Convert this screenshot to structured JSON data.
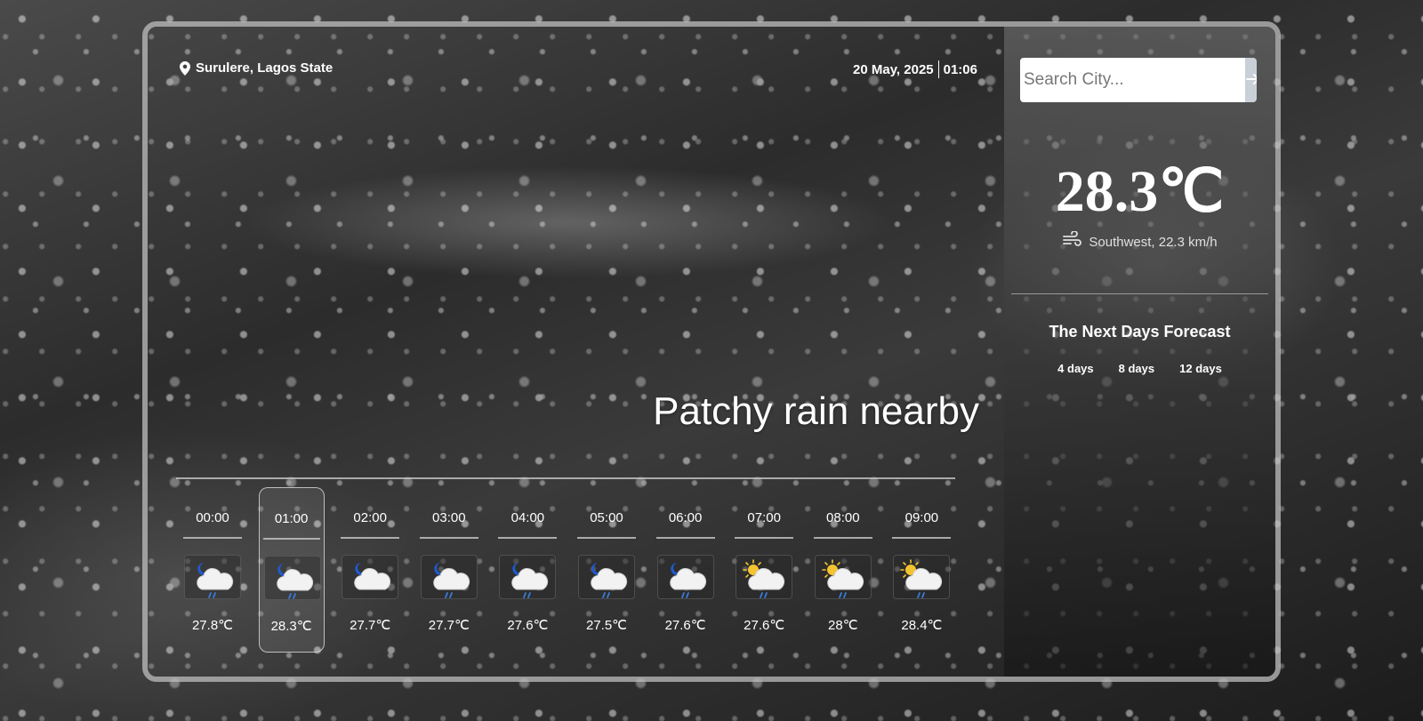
{
  "location": {
    "text": "Surulere, Lagos State",
    "icon": "map-pin-icon"
  },
  "date": "20 May, 2025",
  "time": "01:06",
  "condition": "Patchy rain nearby",
  "hourly": [
    {
      "time": "00:00",
      "temp": "27.8℃",
      "icon": "night-rain-icon",
      "active": false
    },
    {
      "time": "01:00",
      "temp": "28.3℃",
      "icon": "night-rain-icon",
      "active": true
    },
    {
      "time": "02:00",
      "temp": "27.7℃",
      "icon": "night-cloudy-icon",
      "active": false
    },
    {
      "time": "03:00",
      "temp": "27.7℃",
      "icon": "night-rain-icon",
      "active": false
    },
    {
      "time": "04:00",
      "temp": "27.6℃",
      "icon": "night-rain-icon",
      "active": false
    },
    {
      "time": "05:00",
      "temp": "27.5℃",
      "icon": "night-rain-icon",
      "active": false
    },
    {
      "time": "06:00",
      "temp": "27.6℃",
      "icon": "night-rain-icon",
      "active": false
    },
    {
      "time": "07:00",
      "temp": "27.6℃",
      "icon": "day-rain-icon",
      "active": false
    },
    {
      "time": "08:00",
      "temp": "28℃",
      "icon": "day-rain-icon",
      "active": false
    },
    {
      "time": "09:00",
      "temp": "28.4℃",
      "icon": "day-rain-icon",
      "active": false
    }
  ],
  "search": {
    "placeholder": "Search City...",
    "button_icon": "arrow-right-icon"
  },
  "current": {
    "temp": "28.3℃",
    "wind": "Southwest, 22.3 km/h",
    "wind_icon": "wind-icon"
  },
  "forecast": {
    "title": "The Next Days Forecast",
    "options": [
      "4 days",
      "8 days",
      "12 days"
    ]
  },
  "colors": {
    "sun": "#f4c430",
    "moon": "#1e5bd6",
    "rain": "#3a7bd5",
    "cloud": "#f2f2f2"
  }
}
